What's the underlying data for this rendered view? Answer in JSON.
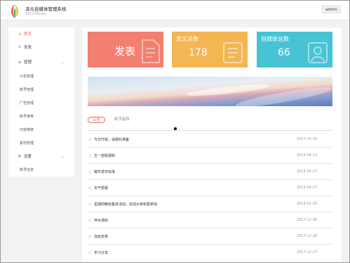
{
  "header": {
    "title": "泽元自媒体管理系统",
    "subtitle": "ZEcorMedia",
    "user": "admin"
  },
  "sidebar": {
    "items": [
      {
        "label": "首页",
        "icon": "home-icon"
      },
      {
        "label": "发表",
        "icon": "edit-icon"
      },
      {
        "label": "管理",
        "icon": "menu-icon"
      },
      {
        "label": "设置",
        "icon": "gear-icon"
      }
    ],
    "manage_sub": [
      "公告管理",
      "账号管理",
      "广告管理",
      "账号审核",
      "内容审核",
      "素材管理"
    ],
    "settings_sub": [
      "账号信息"
    ]
  },
  "cards": [
    {
      "label": "发表",
      "value": "",
      "color": "#f37f70"
    },
    {
      "label": "发文总数",
      "value": "178",
      "color": "#f4b553"
    },
    {
      "label": "自媒体总数",
      "value": "66",
      "color": "#47c3d4"
    }
  ],
  "tabs": [
    "公告",
    "新手指导"
  ],
  "announcements": [
    {
      "title": "今日升级，请做好准备",
      "date": "2017-10-26"
    },
    {
      "title": "五一放假通知",
      "date": "2016-04-23"
    },
    {
      "title": "稿件发布标准",
      "date": "2018-03-27"
    },
    {
      "title": "天气预报",
      "date": "2016-03-27"
    },
    {
      "title": "星期四晚有集体活动，欢迎大家积极参加",
      "date": "2016-01-29"
    },
    {
      "title": "停水通知",
      "date": "2017-12-26"
    },
    {
      "title": "加班安排",
      "date": "2017-12-26"
    },
    {
      "title": "学习分享",
      "date": "2017-12-27"
    }
  ]
}
